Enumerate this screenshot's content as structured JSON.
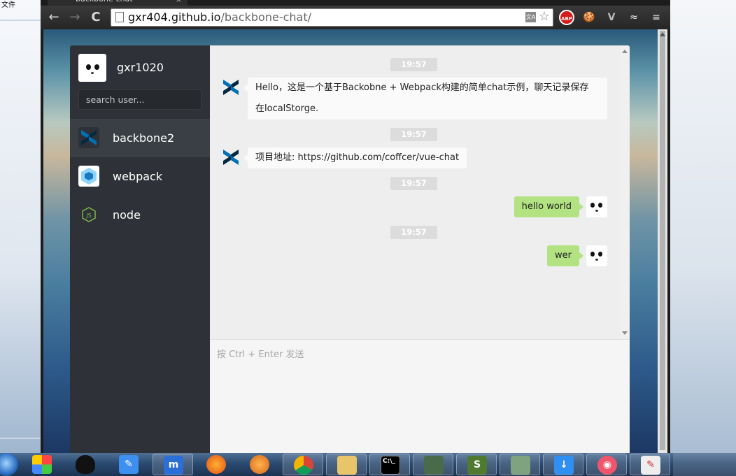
{
  "desktop": {
    "label": "文件"
  },
  "browser": {
    "tab_title": "backbone-chat",
    "tab_close": "×",
    "nav": {
      "back": "←",
      "forward": "→",
      "reload": "C"
    },
    "address": {
      "host": "gxr404.github.io",
      "path": "/backbone-chat/"
    },
    "translate_icon": "文A",
    "star_icon": "☆",
    "extensions": [
      "ABP",
      "🍪",
      "V",
      "≈",
      "≡"
    ]
  },
  "app": {
    "me": {
      "name": "gxr1020"
    },
    "search": {
      "placeholder": "search user..."
    },
    "users": [
      {
        "name": "backbone2",
        "active": true,
        "icon": "backbone-logo-icon"
      },
      {
        "name": "webpack",
        "active": false,
        "icon": "webpack-cube-icon"
      },
      {
        "name": "node",
        "active": false,
        "icon": "nodejs-hexagon-icon"
      }
    ],
    "messages": [
      {
        "time": "19:57",
        "from": "backbone2",
        "self": false,
        "lines": [
          "Hello，这是一个基于Backobne + Webpack构建的简单chat示例，聊天记录保存",
          "在localStorge."
        ]
      },
      {
        "time": "19:57",
        "from": "backbone2",
        "self": false,
        "lines": [
          "项目地址: https://github.com/coffcer/vue-chat"
        ]
      },
      {
        "time": "19:57",
        "from": "gxr1020",
        "self": true,
        "lines": [
          "hello world"
        ]
      },
      {
        "time": "19:57",
        "from": "gxr1020",
        "self": true,
        "lines": [
          "wer"
        ]
      }
    ],
    "composer": {
      "placeholder": "按 Ctrl + Enter 发送"
    }
  },
  "colors": {
    "sidebar_bg": "#2e3238",
    "active_user_bg": "#3a3f45",
    "self_bubble": "#b2e281",
    "other_bubble": "#fafafa",
    "time_badge": "#dcdcdc"
  },
  "taskbar": {
    "items": [
      "start-orb",
      "pinwheel-app",
      "qq-penguin",
      "notes-pen",
      "maxthon",
      "firefox",
      "thunderbird",
      "chrome",
      "file-explorer",
      "command-prompt",
      "evernote",
      "sublime-s",
      "image-tool",
      "download-manager",
      "camera-app",
      "paint-app"
    ]
  }
}
